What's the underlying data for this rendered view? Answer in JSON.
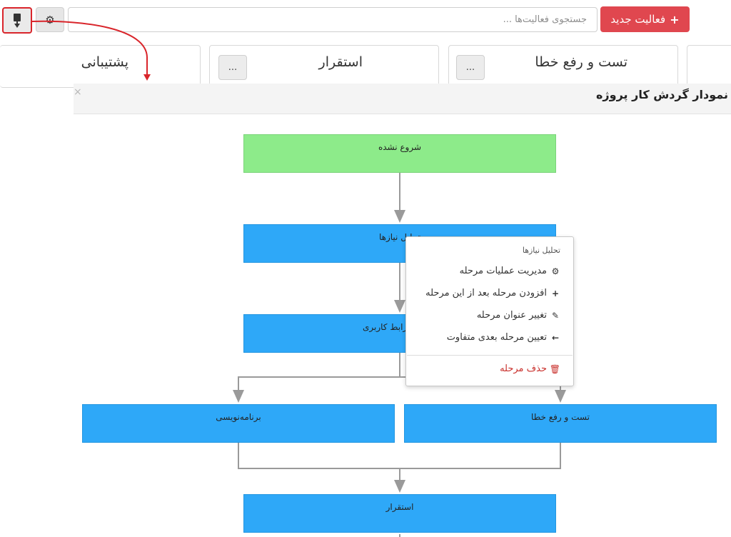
{
  "toolbar": {
    "new_activity_label": "فعالیت جدید",
    "search_placeholder": "جستجوی فعالیت‌ها ..."
  },
  "columns": [
    {
      "title": "تست و رفع خطا",
      "menu_label": "..."
    },
    {
      "title": "استقرار",
      "menu_label": "..."
    },
    {
      "title": "پشتیبانی"
    }
  ],
  "dialog": {
    "title": "نمودار گردش کار پروژه",
    "close_label": "×"
  },
  "flow": {
    "nodes": {
      "not_started": "شروع نشده",
      "requirements": "تحلیل نیازها",
      "ui_design": "رابط کاربری",
      "programming": "برنامه‌نویسی",
      "testing": "تست و رفع خطا",
      "deploy": "استقرار"
    }
  },
  "context_menu": {
    "header": "تحلیل نیازها",
    "items": [
      {
        "label": "مدیریت عملیات مرحله",
        "icon": "gear-icon"
      },
      {
        "label": "افزودن مرحله بعد از این مرحله",
        "icon": "plus-icon"
      },
      {
        "label": "تغییر عنوان مرحله",
        "icon": "edit-icon"
      },
      {
        "label": "تعیین مرحله بعدی متفاوت",
        "icon": "arrow-left-icon"
      }
    ],
    "delete": {
      "label": "حذف مرحله",
      "icon": "trash-icon"
    }
  },
  "colors": {
    "accent_red": "#e0474f",
    "node_green": "#8deb8a",
    "node_blue": "#2ea8f8",
    "annotation_red": "#d9252b"
  }
}
